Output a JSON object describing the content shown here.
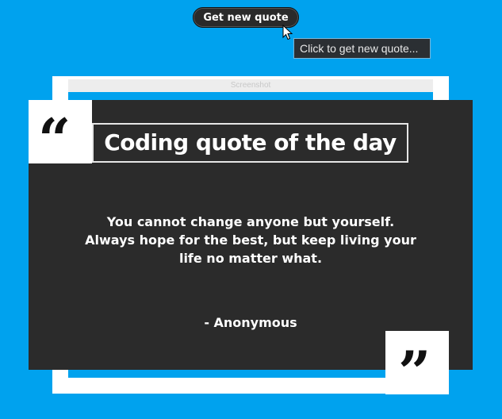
{
  "toolbar": {
    "get_quote_label": "Get new quote",
    "tooltip": "Click to get new quote..."
  },
  "window": {
    "title": "Screenshot"
  },
  "card": {
    "title": "Coding quote of the day",
    "open_quote_glyph": "“",
    "close_quote_glyph": "”",
    "quote": "You cannot change anyone but yourself. Always hope for the best, but keep living your life no matter what.",
    "author": "- Anonymous"
  },
  "colors": {
    "background": "#00a2ee",
    "card": "#2b2b2b",
    "button": "#2a2a2a",
    "text": "#ffffff"
  },
  "icons": {
    "cursor": "mouse-pointer-icon",
    "open_quote": "open-quote-icon",
    "close_quote": "close-quote-icon"
  }
}
